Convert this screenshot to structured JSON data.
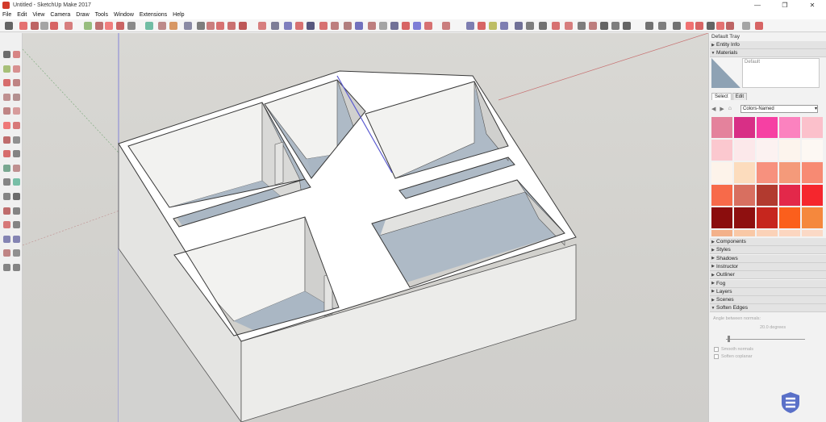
{
  "window": {
    "title": "Untitled - SketchUp Make 2017",
    "controls": [
      "—",
      "❐",
      "✕"
    ]
  },
  "menu": [
    "File",
    "Edit",
    "View",
    "Camera",
    "Draw",
    "Tools",
    "Window",
    "Extensions",
    "Help"
  ],
  "tray": {
    "title": "Default Tray",
    "panels_top": [
      {
        "label": "Entity Info",
        "expanded": false
      },
      {
        "label": "Materials",
        "expanded": true
      }
    ],
    "materials": {
      "name": "Default",
      "tabs": [
        "Select",
        "Edit"
      ],
      "library": "Colors-Named",
      "swatches": [
        "#e4829c",
        "#d82f86",
        "#f640a3",
        "#fb82bf",
        "#fbc0cb",
        "#fbc8cf",
        "#fce8ea",
        "#fcf2f1",
        "#fdf4ed",
        "#fdf8f3",
        "#fdf3ea",
        "#fcdcbd",
        "#f7917e",
        "#f49a7a",
        "#f78a73",
        "#f76a4a",
        "#d86f60",
        "#b23a2f",
        "#e3284a",
        "#f5262d",
        "#8b0d0d",
        "#8f1010",
        "#c6261e",
        "#fb5f1c",
        "#f5883d",
        "#f3b18a",
        "#f9c8a6",
        "#fbd2b8",
        "#fcd6c0",
        "#fbd9c6"
      ]
    },
    "panels_bottom": [
      {
        "label": "Components",
        "expanded": false
      },
      {
        "label": "Styles",
        "expanded": false
      },
      {
        "label": "Shadows",
        "expanded": false
      },
      {
        "label": "Instructor",
        "expanded": false
      },
      {
        "label": "Outliner",
        "expanded": false
      },
      {
        "label": "Fog",
        "expanded": false
      },
      {
        "label": "Layers",
        "expanded": false
      },
      {
        "label": "Scenes",
        "expanded": false
      },
      {
        "label": "Soften Edges",
        "expanded": true
      }
    ],
    "soften_edges": {
      "angle_label": "Angle between normals:",
      "angle_value": "20.0 degrees",
      "smooth_normals": "Smooth normals",
      "soften_coplanar": "Soften coplanar"
    }
  },
  "colors": {
    "accent_red": "#d23a2a",
    "floor": "#aebac6",
    "wall_top": "#ffffff",
    "wall_side": "#e9e9e7",
    "wall_dark": "#d4d4d2",
    "axis_red": "#c23a3a",
    "axis_green": "#5c9c5c",
    "axis_blue": "#5b5bd0",
    "logo_blue": "#5a70c8"
  }
}
